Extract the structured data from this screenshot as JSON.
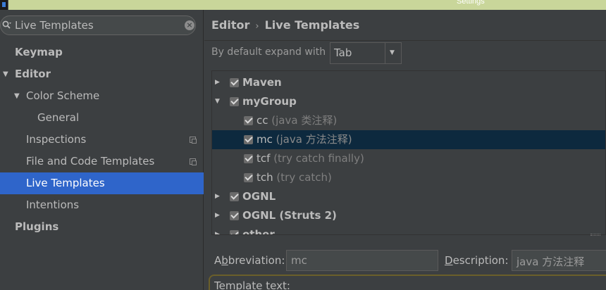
{
  "window": {
    "title": "Settings"
  },
  "search": {
    "value": "Live Templates",
    "placeholder": ""
  },
  "sidebar": {
    "items": [
      {
        "label": "Keymap"
      },
      {
        "label": "Editor"
      },
      {
        "label": "Color Scheme"
      },
      {
        "label": "General"
      },
      {
        "label": "Inspections"
      },
      {
        "label": "File and Code Templates"
      },
      {
        "label": "Live Templates"
      },
      {
        "label": "Intentions"
      },
      {
        "label": "Plugins"
      }
    ]
  },
  "breadcrumb": {
    "parent": "Editor",
    "separator": "›",
    "current": "Live Templates"
  },
  "expand": {
    "label": "By default expand with",
    "value": "Tab"
  },
  "templates": [
    {
      "name": "Maven",
      "desc": ""
    },
    {
      "name": "myGroup",
      "desc": ""
    },
    {
      "name": "cc",
      "desc": "(java 类注释)"
    },
    {
      "name": "mc",
      "desc": "(java 方法注释)"
    },
    {
      "name": "tcf",
      "desc": "(try catch finally)"
    },
    {
      "name": "tch",
      "desc": "(try catch)"
    },
    {
      "name": "OGNL",
      "desc": ""
    },
    {
      "name": "OGNL (Struts 2)",
      "desc": ""
    },
    {
      "name": "other",
      "desc": ""
    }
  ],
  "editor": {
    "abbreviation_label_pre": "A",
    "abbreviation_label_mnemonic": "b",
    "abbreviation_label_post": "breviation:",
    "abbreviation_value": "mc",
    "description_label_mnemonic": "D",
    "description_label_post": "escription:",
    "description_value": "java 方法注释",
    "template_text_label_mnemonic": "T",
    "template_text_label_post": "emplate text:"
  },
  "colors": {
    "selection": "#2f65ca",
    "row_selection": "#0d293e",
    "background": "#3c3f41"
  }
}
